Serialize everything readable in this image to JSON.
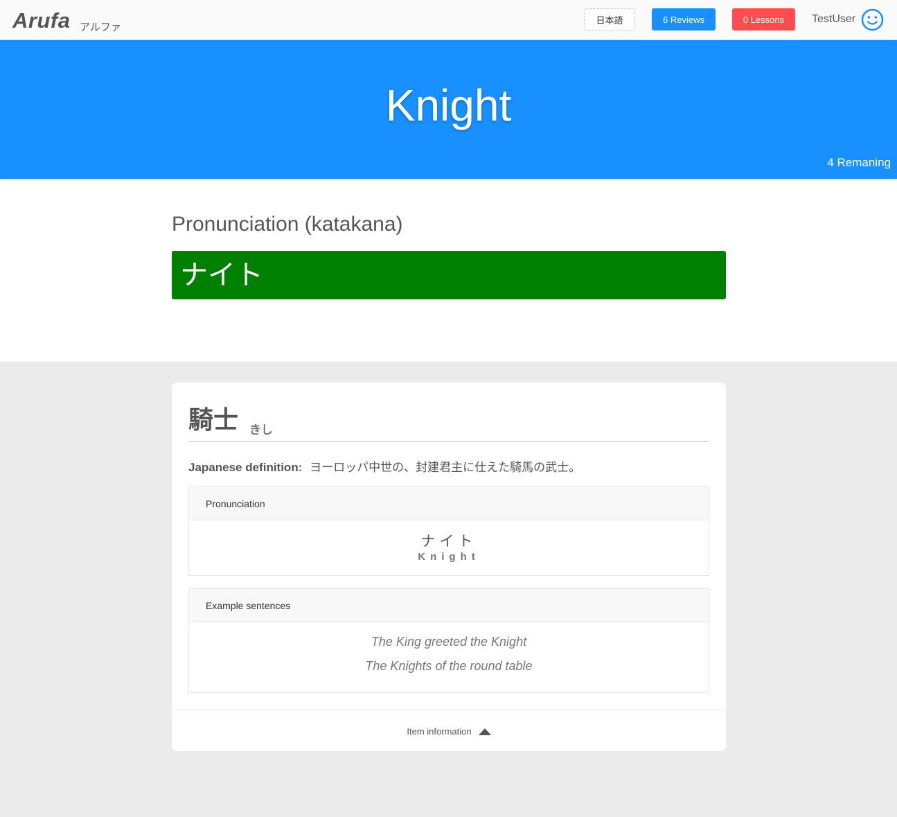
{
  "nav": {
    "brand": "Arufa",
    "brand_sub": "アルファ",
    "lang_label": "日本語",
    "reviews_label": "6 Reviews",
    "lessons_label": "0 Lessons",
    "username": "TestUser",
    "colors": {
      "reviews": "#1890ff",
      "lessons": "#ff4d4f"
    }
  },
  "hero": {
    "word": "Knight",
    "remaining": "4 Remaning",
    "color": "#1890ff"
  },
  "answer": {
    "label": "Pronunciation (katakana)",
    "value": "ナイト",
    "status_color": "#008000"
  },
  "card": {
    "kanji": "騎士",
    "reading": "きし",
    "definition_label": "Japanese definition:",
    "definition_text": "ヨーロッパ中世の、封建君主に仕えた騎馬の武士。",
    "pronunciation_title": "Pronunciation",
    "pronunciation_kana": "ナイト",
    "pronunciation_roman": "Knight",
    "examples_title": "Example sentences",
    "examples": [
      "The King greeted the Knight",
      "The Knights of the round table"
    ],
    "footer_label": "Item information",
    "footer_icon": "caret-up-icon"
  }
}
